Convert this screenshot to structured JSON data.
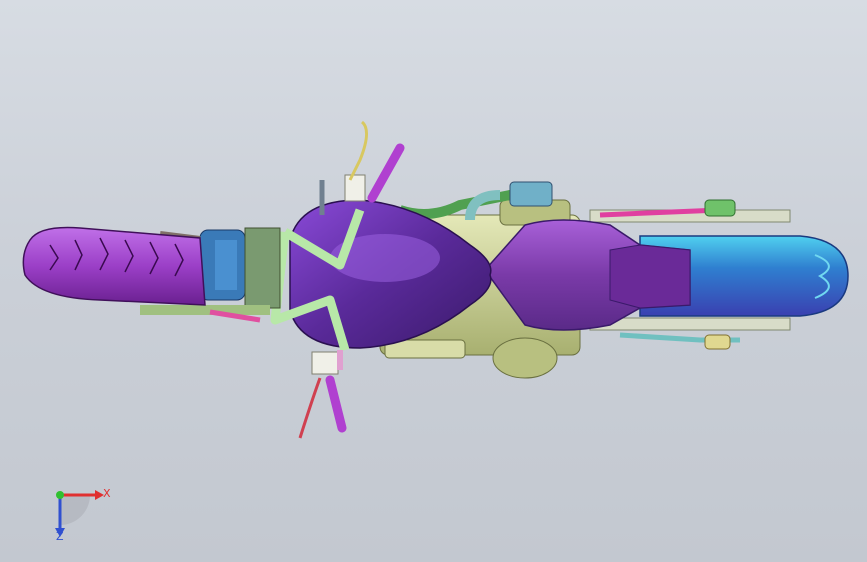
{
  "viewport": {
    "background_top": "#d7dce3",
    "background_bottom": "#c3c8d0"
  },
  "model": {
    "subject": "motorcycle-top-view",
    "colors": {
      "tire": "#9b3fc7",
      "tank": "#5a2a9a",
      "seat": "#7a3aa8",
      "exhaust_blue": "#2f7fd0",
      "frame": "#d4f0c8",
      "engine_yellow": "#cfd6a0",
      "green_part": "#6fc26a",
      "pink_part": "#e040a0",
      "fork_blue": "#3a7ab8"
    }
  },
  "triad": {
    "x_label": "X",
    "z_label": "Z",
    "x_color": "#e03030",
    "z_color": "#3050d0",
    "origin_color": "#30c030"
  }
}
